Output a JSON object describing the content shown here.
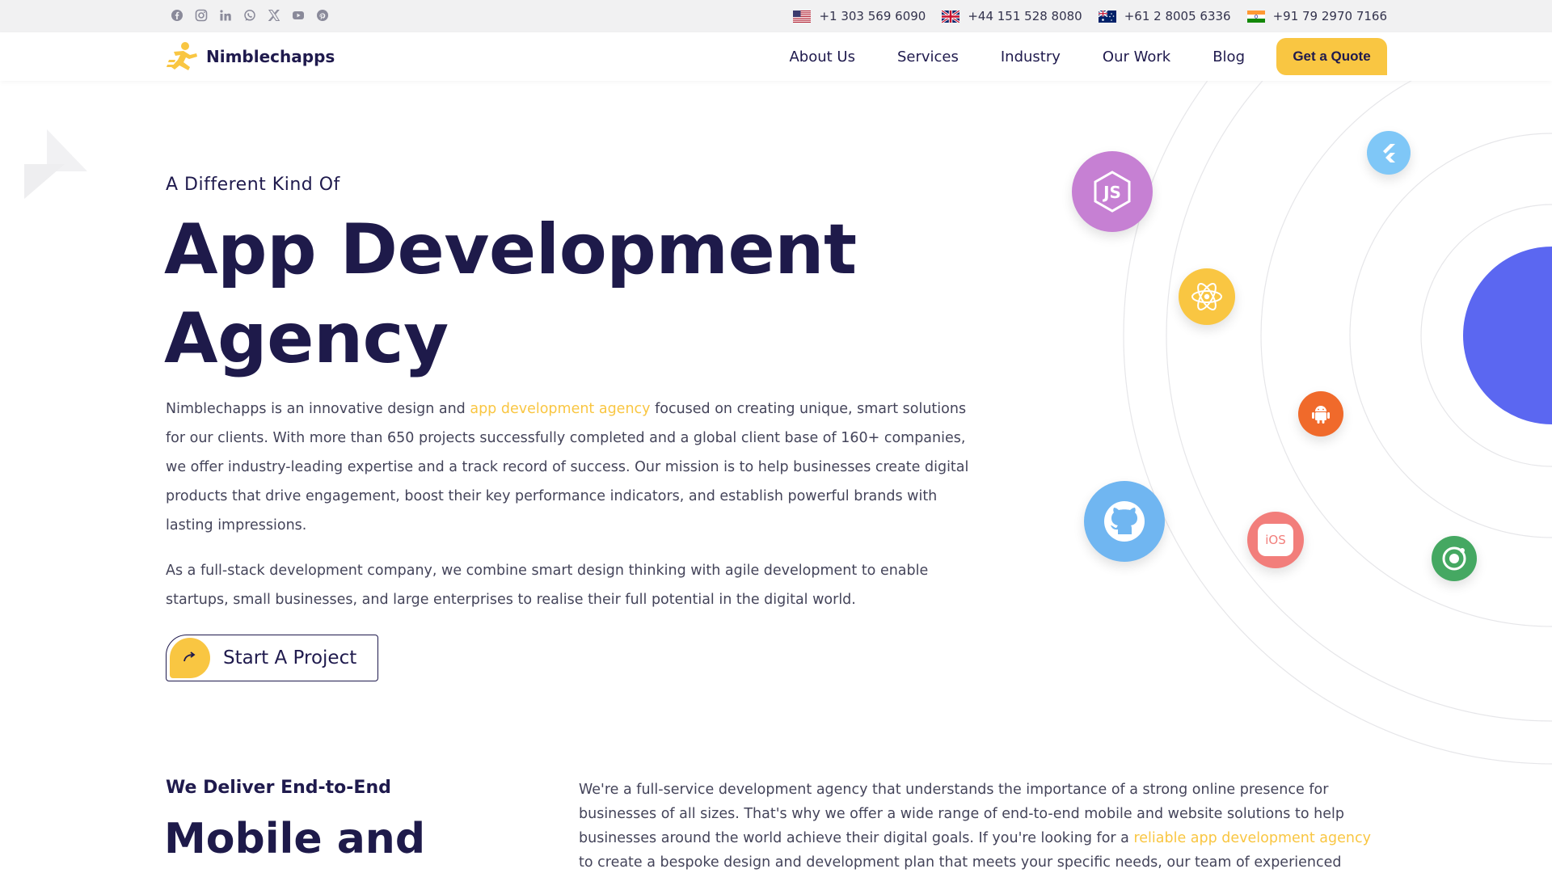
{
  "topbar": {
    "socials": [
      "facebook-icon",
      "instagram-icon",
      "linkedin-icon",
      "whatsapp-icon",
      "x-icon",
      "youtube-icon",
      "pinterest-icon"
    ],
    "phones": [
      {
        "flag": "us-flag-icon",
        "number": "+1 303 569 6090"
      },
      {
        "flag": "uk-flag-icon",
        "number": "+44 151 528 8080"
      },
      {
        "flag": "au-flag-icon",
        "number": "+61 2 8005 6336"
      },
      {
        "flag": "in-flag-icon",
        "number": "+91 79 2970 7166"
      }
    ]
  },
  "header": {
    "logo_text": "Nimblechapps",
    "nav": [
      "About Us",
      "Services",
      "Industry",
      "Our Work",
      "Blog"
    ],
    "cta": "Get a Quote"
  },
  "hero": {
    "eyebrow": "A Different Kind Of",
    "title_line1": "App Development",
    "title_line2": "Agency",
    "para1_a": "Nimblechapps is an innovative design and ",
    "para1_link": "app development agency",
    "para1_b": " focused on creating unique, smart solutions for our clients. With more than 650 projects successfully completed and a global client base of 160+ companies, we offer industry-leading expertise and a track record of success. Our mission is to help businesses create digital products that drive engagement, boost their key performance indicators, and establish powerful brands with lasting impressions.",
    "para2": "As a full-stack development company, we combine smart design thinking with agile development to enable startups, small businesses, and large enterprises to realise their full potential in the digital world.",
    "button": "Start A Project",
    "tech_icons": [
      "nodejs-icon",
      "flutter-icon",
      "react-icon",
      "android-icon",
      "github-icon",
      "ios-icon",
      "ionic-icon"
    ],
    "ios_label": "iOS"
  },
  "section2": {
    "eyebrow": "We Deliver End-to-End",
    "title": "Mobile and",
    "para_a": "We're a full-service development agency that understands the importance of a strong online presence for businesses of all sizes. That's why we offer a wide range of end-to-end mobile and website solutions to help businesses around the world achieve their digital goals. If you're looking for a ",
    "para_link": "reliable app development agency",
    "para_b": " to create a bespoke design and development plan that meets your specific needs, our team of experienced"
  },
  "colors": {
    "accent": "#f9c642",
    "navy": "#1e1a4a",
    "orbit_blue": "#5b67f1"
  }
}
